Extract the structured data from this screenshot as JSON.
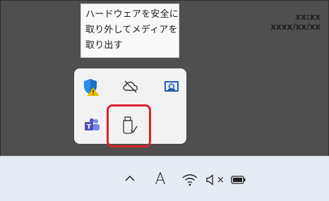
{
  "tooltip": {
    "lines": [
      "ハードウェアを安全に",
      "取り外してメディアを",
      "取り出す"
    ]
  },
  "tray_overflow": {
    "icons": [
      "security-warning-icon",
      "cloud-offline-icon",
      "display-app-icon",
      "teams-icon",
      "usb-eject-icon"
    ]
  },
  "taskbar": {
    "chevron_glyph": "^",
    "ime_label": "A",
    "mute_glyph": "×",
    "time": "xx:xx",
    "date": "xxxx/xx/xx"
  },
  "colors": {
    "highlight": "#d9222a",
    "background": "#4f4f4f",
    "taskbar": "#e6ecf3",
    "tray_panel": "#f2f2f2"
  }
}
